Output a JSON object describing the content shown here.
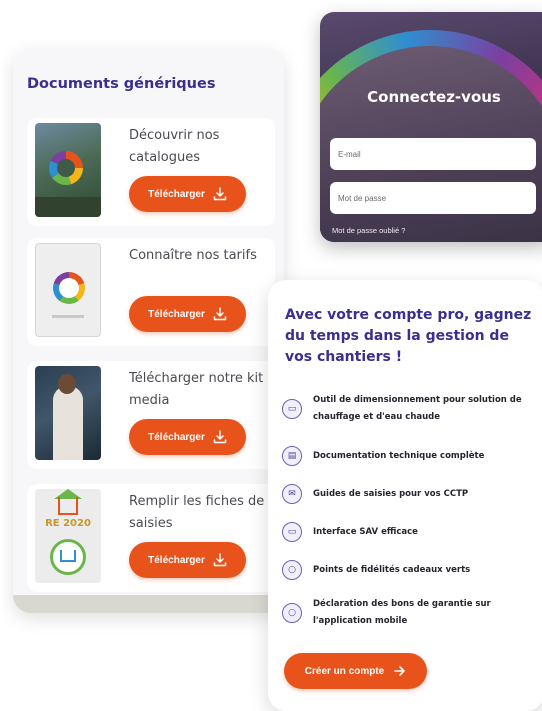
{
  "documents": {
    "title": "Documents génériques",
    "items": [
      {
        "label": "Découvrir nos catalogues",
        "button": "Télécharger",
        "thumb": "catalog-cover-image"
      },
      {
        "label": "Connaître nos tarifs",
        "button": "Télécharger",
        "thumb": "tarifs-cover-image"
      },
      {
        "label": "Télécharger notre kit media",
        "button": "Télécharger",
        "thumb": "kit-media-photo"
      },
      {
        "label": "Remplir les fiches de saisies",
        "button": "Télécharger",
        "thumb": "re2020-logo"
      }
    ],
    "re_label": "RE 2020"
  },
  "login": {
    "title": "Connectez-vous",
    "email_placeholder": "E-mail",
    "password_placeholder": "Mot de passe",
    "forgot_link": "Mot de passe oublié ?"
  },
  "pro": {
    "title": "Avec votre compte pro, gagnez du temps dans la gestion de vos chantiers !",
    "features": [
      {
        "icon": "folder-icon",
        "text": "Outil de dimensionnement pour solution de chauffage et d'eau chaude"
      },
      {
        "icon": "document-icon",
        "text": "Documentation technique complète"
      },
      {
        "icon": "guide-icon",
        "text": "Guides de saisies pour vos CCTP"
      },
      {
        "icon": "service-icon",
        "text": "Interface SAV efficace"
      },
      {
        "icon": "points-icon",
        "text": "Points de fidélités cadeaux verts"
      },
      {
        "icon": "warranty-icon",
        "text": "Déclaration des bons de garantie sur l'application mobile"
      }
    ],
    "create_button": "Créer un compte"
  },
  "colors": {
    "accent_orange": "#e8531c",
    "title_purple": "#3a2f8f",
    "card_bg": "#f7f6f8"
  }
}
